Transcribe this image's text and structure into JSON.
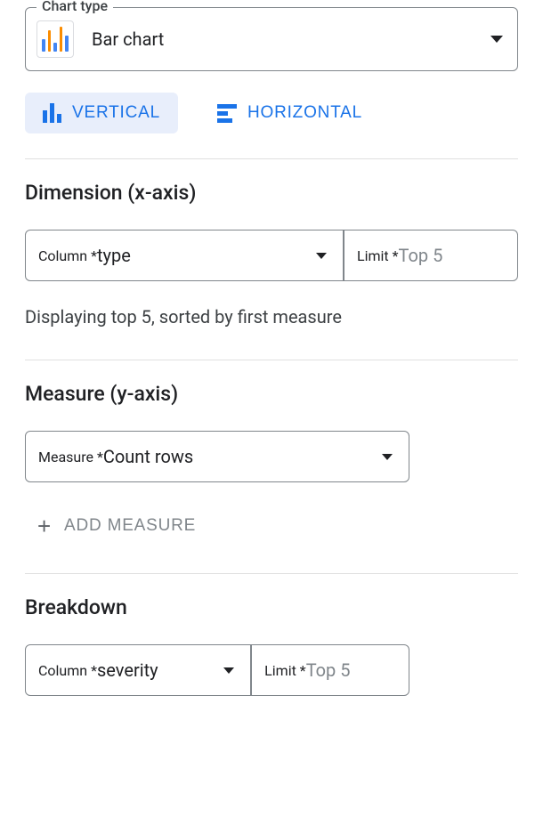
{
  "chartType": {
    "legend": "Chart type",
    "value": "Bar chart"
  },
  "orientation": {
    "vertical": "VERTICAL",
    "horizontal": "HORIZONTAL"
  },
  "dimension": {
    "title": "Dimension (x-axis)",
    "columnLegend": "Column *",
    "columnValue": "type",
    "limitLegend": "Limit *",
    "limitValue": "Top 5",
    "info": "Displaying top 5, sorted by first measure"
  },
  "measure": {
    "title": "Measure (y-axis)",
    "legend": "Measure *",
    "value": "Count rows",
    "addLabel": "ADD MEASURE"
  },
  "breakdown": {
    "title": "Breakdown",
    "columnLegend": "Column *",
    "columnValue": "severity",
    "limitLegend": "Limit *",
    "limitValue": "Top 5"
  },
  "colors": {
    "blue": "#4285f4",
    "orange": "#fb8c00"
  }
}
